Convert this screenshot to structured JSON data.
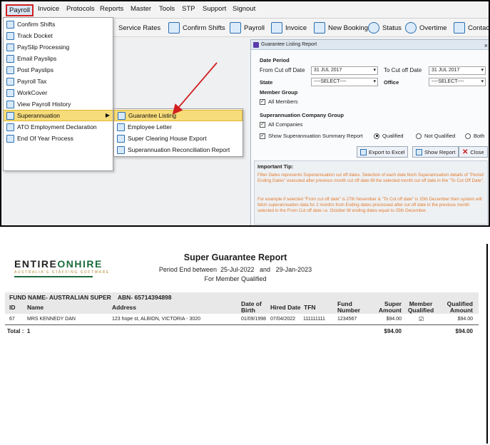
{
  "menubar": {
    "items": [
      "Payroll",
      "Invoice",
      "Protocols",
      "Reports",
      "Master",
      "Tools",
      "STP",
      "Support",
      "Signout"
    ]
  },
  "toolbar": {
    "items": [
      {
        "label": "Service Rates",
        "icon": "service-rates-icon"
      },
      {
        "label": "Confirm Shifts",
        "icon": "calendar-icon"
      },
      {
        "label": "Payroll",
        "icon": "payroll-icon"
      },
      {
        "label": "Invoice",
        "icon": "invoice-icon"
      },
      {
        "label": "New Booking",
        "icon": "booking-icon"
      },
      {
        "label": "Status",
        "icon": "status-clock-icon"
      },
      {
        "label": "Overtime",
        "icon": "overtime-clock-icon"
      },
      {
        "label": "Contac",
        "icon": "contact-card-icon"
      }
    ]
  },
  "payroll_menu": {
    "items": [
      {
        "label": "Confirm Shifts"
      },
      {
        "label": "Track Docket"
      },
      {
        "label": "PaySlip Processing"
      },
      {
        "label": "Email Payslips"
      },
      {
        "label": "Post Payslips"
      },
      {
        "label": "Payroll Tax"
      },
      {
        "label": "WorkCover"
      },
      {
        "label": "View Payroll History"
      },
      {
        "label": "Superannuation"
      },
      {
        "label": "ATO Employment Declaration"
      },
      {
        "label": "End Of Year Process"
      }
    ],
    "submenu_arrow": "▶"
  },
  "superannuation_submenu": {
    "items": [
      {
        "label": "Guarantee Listing"
      },
      {
        "label": "Employee Letter"
      },
      {
        "label": "Super Clearing House Export"
      },
      {
        "label": "Superannuation Reconciliation Report"
      }
    ]
  },
  "dialog": {
    "title": "Guarantee Listing Report",
    "close_glyph": "×",
    "date_period_heading": "Date Period",
    "from_label": "From Cut off Date",
    "from_value": "31 JUL 2017",
    "to_label": "To Cut off Date",
    "to_value": "31 JUL 2017",
    "state_label": "State",
    "state_value": "----SELECT----",
    "office_label": "Office",
    "office_value": "----SELECT----",
    "member_group_heading": "Member Group",
    "all_members_label": "All Members",
    "company_group_heading": "Superannuation Company Group",
    "all_companies_label": "All Companies",
    "show_summary_label": "Show Superannuation Summary Report",
    "radio_qualified": "Qualified",
    "radio_not_qualified": "Not Qualified",
    "radio_both": "Both",
    "export_button": "Export to Excel",
    "show_report_button": "Show Report",
    "close_button": "Close",
    "tip_heading": "Important Tip:",
    "tip_line1": "Filter Dates represents Superannuation cut off dates. Selection of each date fetch Superannuation details of \"Period Ending Dates\" executed after previous month cut off date till the selected month cut off date in the \"To Cut Off Date\".",
    "tip_line2": "For example if selected \"From cut off date\" is 27th November & \"To Cut off date\" is 25th December then system will fetch superannuation data for 2 months from Ending dates processed after cut off date in the previous month selected in the From Cut off date i.e. October till ending dates equal to 25th December."
  },
  "report": {
    "logo_part1": "ENTIRE",
    "logo_part2": "ONHIRE",
    "logo_tagline": "AUSTRALIA'S STAFFING SOFTWARE",
    "title": "Super Guarantee Report",
    "period_prefix": "Period End between",
    "period_from": "25-Jul-2022",
    "period_and": "and",
    "period_to": "29-Jan-2023",
    "member_line": "For  Member Qualified",
    "fund_label": "FUND NAME- AUSTRALIAN SUPER",
    "abn_label": "ABN- 65714394898",
    "columns": {
      "id": "ID",
      "name": "Name",
      "address": "Address",
      "dob": "Date of Birth",
      "hired": "Hired Date",
      "tfn": "TFN",
      "fund_number": "Fund Number",
      "super_amount": "Super Amount",
      "member_qualified": "Member Qualified",
      "qualified_amount": "Qualified Amount"
    },
    "rows": [
      {
        "id": "67",
        "name": "MRS  KENNEDY DAN",
        "address": "123 hope st, ALBION, VICTORIA - 3020",
        "dob": "01/09/1998",
        "hired": "07/04/2022",
        "tfn": "111111111",
        "fund_number": "1234567",
        "super_amount": "$94.00",
        "member_qualified": "☑",
        "qualified_amount": "$94.00"
      }
    ],
    "total_label": "Total :",
    "total_count": "1",
    "total_super": "$94.00",
    "total_qualified": "$94.00"
  },
  "colors": {
    "highlight": "#f7dc7a",
    "accent_red": "#d21f1f",
    "tip_orange": "#e27a2d",
    "brand_green": "#1b6c3b"
  }
}
